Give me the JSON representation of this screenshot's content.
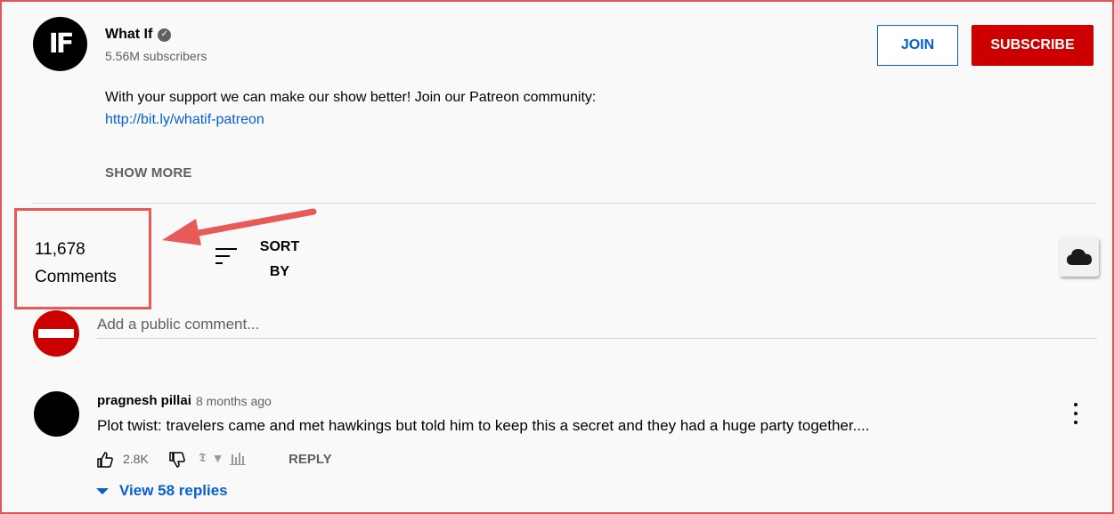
{
  "channel": {
    "avatar_text": "IF",
    "name": "What If",
    "verified_icon": "checkmark-icon",
    "subscribers": "5.56M subscribers",
    "join_label": "JOIN",
    "subscribe_label": "SUBSCRIBE"
  },
  "description": {
    "text": "With your support we can make our show better! Join our Patreon community:",
    "link": "http://bit.ly/whatif-patreon",
    "show_more": "SHOW MORE"
  },
  "comments_header": {
    "count": "11,678",
    "label": "Comments",
    "sort_line1": "SORT",
    "sort_line2": "BY"
  },
  "add_comment": {
    "placeholder": "Add a public comment..."
  },
  "comments": [
    {
      "author": "pragnesh pillai",
      "time": "8 months ago",
      "text": "Plot twist: travelers came and met hawkings but told him to keep this a secret and they had a huge party together....",
      "likes": "2.8K",
      "reply_label": "REPLY",
      "view_replies": "View 58 replies"
    }
  ],
  "colors": {
    "brand_red": "#cc0000",
    "link_blue": "#065fd4",
    "annotation_red": "#e85a5a"
  }
}
